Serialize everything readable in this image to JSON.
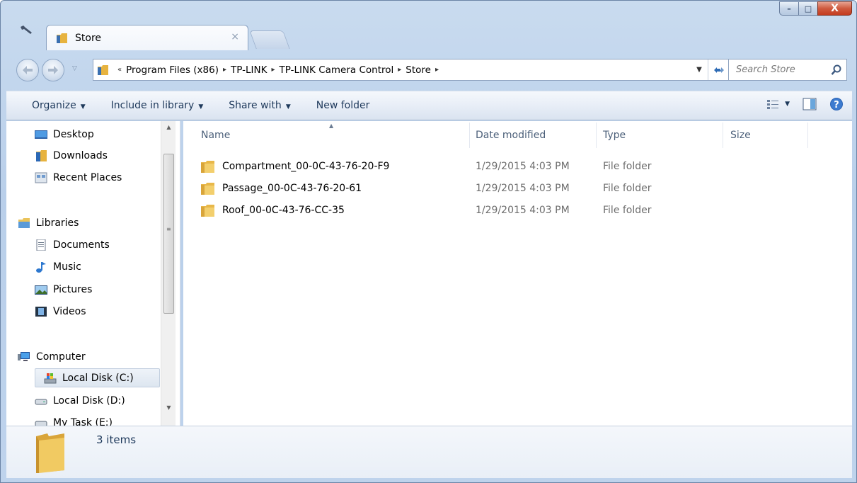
{
  "window": {
    "tab_label": "Store",
    "tab_close": "×",
    "caption": {
      "minimize": "–",
      "maximize": "□",
      "close": "X"
    }
  },
  "address_bar": {
    "overflow": "«",
    "breadcrumbs": [
      "Program Files (x86)",
      "TP-LINK",
      "TP-LINK Camera Control",
      "Store"
    ],
    "separator": "▸"
  },
  "search": {
    "placeholder": "Search Store"
  },
  "command_bar": {
    "organize": "Organize",
    "include_in_library": "Include in library",
    "share_with": "Share with",
    "new_folder": "New folder"
  },
  "nav_pane": {
    "items": [
      {
        "label": "Desktop",
        "icon": "desktop-icon"
      },
      {
        "label": "Downloads",
        "icon": "downloads-icon"
      },
      {
        "label": "Recent Places",
        "icon": "recent-places-icon"
      },
      {
        "label": "Libraries",
        "icon": "libraries-icon"
      },
      {
        "label": "Documents",
        "icon": "documents-icon"
      },
      {
        "label": "Music",
        "icon": "music-icon"
      },
      {
        "label": "Pictures",
        "icon": "pictures-icon"
      },
      {
        "label": "Videos",
        "icon": "videos-icon"
      },
      {
        "label": "Computer",
        "icon": "computer-icon"
      },
      {
        "label": "Local Disk (C:)",
        "icon": "system-drive-icon",
        "selected": true
      },
      {
        "label": "Local Disk (D:)",
        "icon": "drive-icon"
      },
      {
        "label": "My Task (E:)",
        "icon": "drive-icon"
      }
    ]
  },
  "file_list": {
    "columns": {
      "name": "Name",
      "date_modified": "Date modified",
      "type": "Type",
      "size": "Size"
    },
    "rows": [
      {
        "name": "Compartment_00-0C-43-76-20-F9",
        "date": "1/29/2015 4:03 PM",
        "type": "File folder"
      },
      {
        "name": "Passage_00-0C-43-76-20-61",
        "date": "1/29/2015 4:03 PM",
        "type": "File folder"
      },
      {
        "name": "Roof_00-0C-43-76-CC-35",
        "date": "1/29/2015 4:03 PM",
        "type": "File folder"
      }
    ]
  },
  "details_pane": {
    "count": "3 items"
  },
  "colors": {
    "folder": "#e8b84a",
    "frame": "#bed3ec",
    "text": "#1e395b",
    "close": "#c43b1f"
  }
}
